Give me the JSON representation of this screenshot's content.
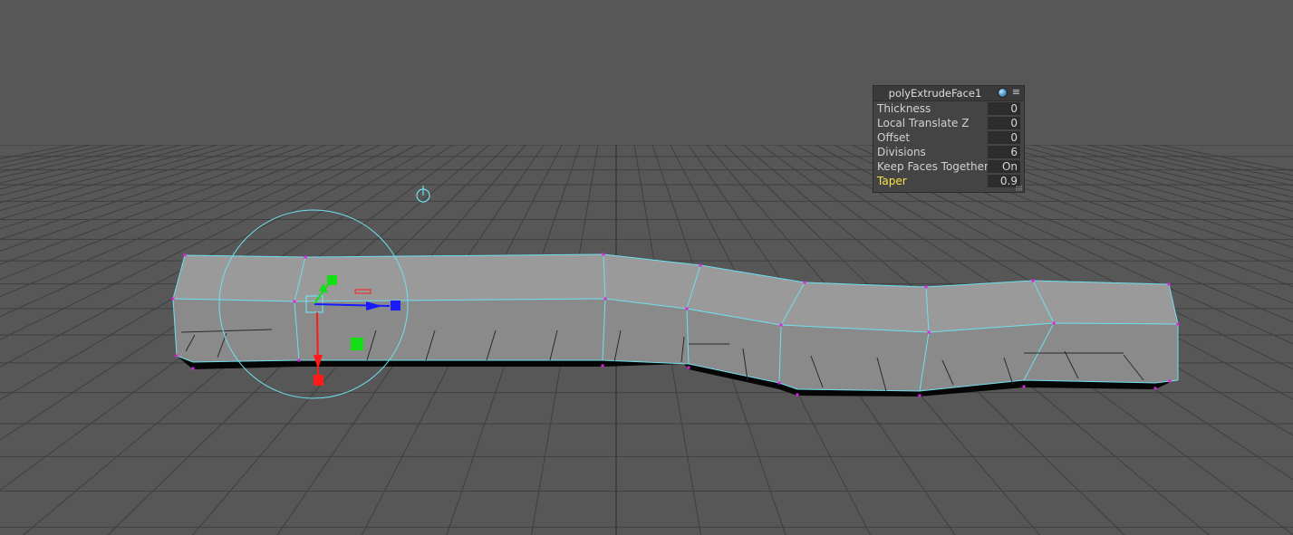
{
  "viewport": {
    "background_color": "#575757",
    "grid_color": "#3f3f3f",
    "selection_color": "#6fe0ee",
    "vertex_color": "#e020e0",
    "mesh_fill": "#8e8e8e"
  },
  "manipulator": {
    "x_axis_color": "#ff1a1a",
    "y_axis_color": "#12e012",
    "z_axis_color": "#1a1aff",
    "center_icon": "pivot-square-icon",
    "pivot_icon": "pivot-marker-icon"
  },
  "attribute_panel": {
    "title": "polyExtrudeFace1",
    "globe_icon": "globe-icon",
    "menu_icon": "hamburger-menu-icon",
    "rows": [
      {
        "label": "Thickness",
        "value": "0"
      },
      {
        "label": "Local Translate Z",
        "value": "0"
      },
      {
        "label": "Offset",
        "value": "0"
      },
      {
        "label": "Divisions",
        "value": "6"
      },
      {
        "label": "Keep Faces Together",
        "value": "On"
      },
      {
        "label": "Taper",
        "value": "0.9"
      }
    ],
    "highlight_color": "#f5e64b"
  }
}
